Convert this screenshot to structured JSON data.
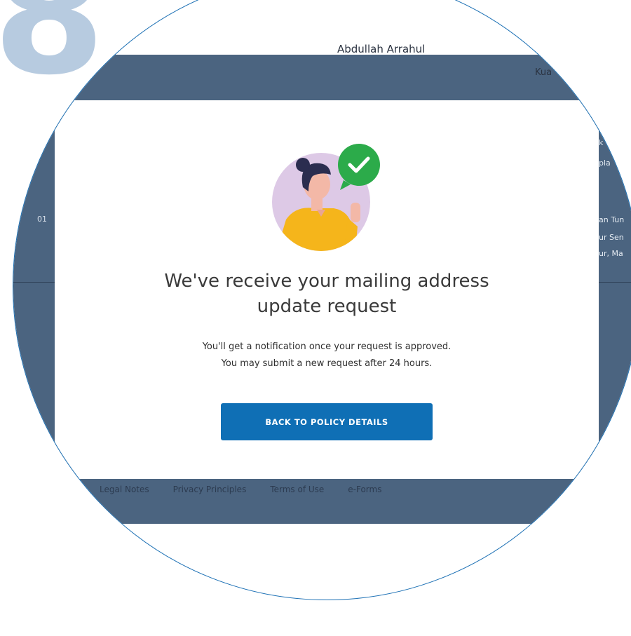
{
  "step": {
    "number": "8"
  },
  "background": {
    "header_name": "Abdullah Arrahul",
    "header_right": "Kua",
    "left_text": "01",
    "right_texts": [
      "k",
      "pla",
      "an Tun",
      "ur Sen",
      "ur, Ma"
    ],
    "footer_links": [
      "Legal Notes",
      "Privacy Principles",
      "Terms of Use",
      "e-Forms"
    ]
  },
  "modal": {
    "headline_lines": [
      "We've receive your mailing address",
      "update request"
    ],
    "description_lines": [
      "You'll get a notification once your request is approved.",
      "You may submit a new request after 24 hours."
    ],
    "button_label": "BACK TO POLICY DETAILS"
  },
  "colors": {
    "step_number": "#b7cbe0",
    "circle_border": "#1a6fb4",
    "background_band": "#4b6480",
    "button": "#0f6fb5",
    "check_badge": "#2cab4a",
    "avatar_circle": "#ddc9e6",
    "shirt": "#f5b51b"
  }
}
